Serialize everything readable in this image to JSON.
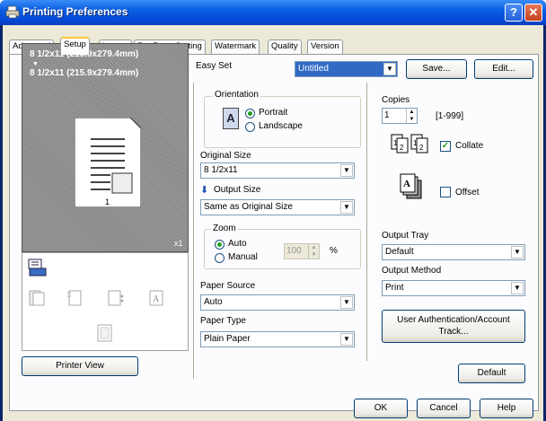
{
  "window": {
    "title": "Printing Preferences",
    "help_glyph": "?",
    "close_glyph": "✕"
  },
  "tabs": [
    "Advanced",
    "Setup",
    "Layout",
    "Per Page Setting",
    "Watermark",
    "Quality",
    "Version"
  ],
  "active_tab": "Setup",
  "preview": {
    "paper_line": "8 1/2x11 (215.9x279.4mm)",
    "output_line": "8 1/2x11 (215.9x279.4mm)",
    "arrow": "▼",
    "copies_mark": "x1"
  },
  "printer_view_button": "Printer View",
  "easy_set": {
    "label": "Easy Set",
    "value": "Untitled",
    "save_button": "Save...",
    "edit_button": "Edit..."
  },
  "orientation": {
    "label": "Orientation",
    "portrait": "Portrait",
    "landscape": "Landscape",
    "selected": "Portrait",
    "page_glyph": "A"
  },
  "original_size": {
    "label": "Original Size",
    "value": "8 1/2x11"
  },
  "output_size": {
    "label": "Output Size",
    "value": "Same as Original Size"
  },
  "zoom": {
    "label": "Zoom",
    "auto": "Auto",
    "manual": "Manual",
    "selected": "Auto",
    "value": "100",
    "unit": "%"
  },
  "paper_source": {
    "label": "Paper Source",
    "value": "Auto"
  },
  "paper_type": {
    "label": "Paper Type",
    "value": "Plain Paper"
  },
  "copies": {
    "label": "Copies",
    "value": "1",
    "range": "[1-999]"
  },
  "collate": {
    "label": "Collate",
    "checked": true,
    "check_glyph": "✓"
  },
  "offset": {
    "label": "Offset",
    "checked": false
  },
  "output_tray": {
    "label": "Output Tray",
    "value": "Default"
  },
  "output_method": {
    "label": "Output Method",
    "value": "Print"
  },
  "user_auth_button": {
    "line1": "User Authentication/Account",
    "line2": "Track..."
  },
  "default_button": "Default",
  "footer": {
    "ok": "OK",
    "cancel": "Cancel",
    "help": "Help"
  },
  "combo_arrow": "▼",
  "colors": {
    "titlebar": "#0a5ee0",
    "selection": "#316ac5",
    "dialog_bg": "#ece9d8",
    "tab_highlight": "#ffc83c"
  }
}
